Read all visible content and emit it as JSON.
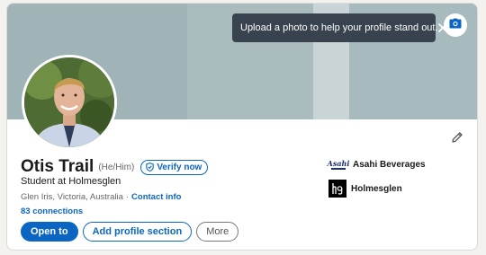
{
  "tooltip": {
    "text": "Upload a photo to help your profile stand out.",
    "close_icon": "close-icon"
  },
  "cover": {
    "camera_icon": "camera-icon"
  },
  "profile": {
    "name": "Otis Trail",
    "pronouns": "(He/Him)",
    "verify_label": "Verify now",
    "headline": "Student at Holmesglen",
    "location": "Glen Iris, Victoria, Australia",
    "separator": "·",
    "contact_info": "Contact info",
    "connections": "83 connections"
  },
  "actions": {
    "open_to": "Open to",
    "add_section": "Add profile section",
    "more": "More"
  },
  "affiliations": [
    {
      "name": "Asahi Beverages",
      "logo": "asahi-logo",
      "logo_text": "Asahi"
    },
    {
      "name": "Holmesglen",
      "logo": "holmesglen-logo"
    }
  ],
  "colors": {
    "accent": "#0a66c2",
    "cover": "#a0b4b7",
    "tooltip_bg": "#38434f"
  }
}
